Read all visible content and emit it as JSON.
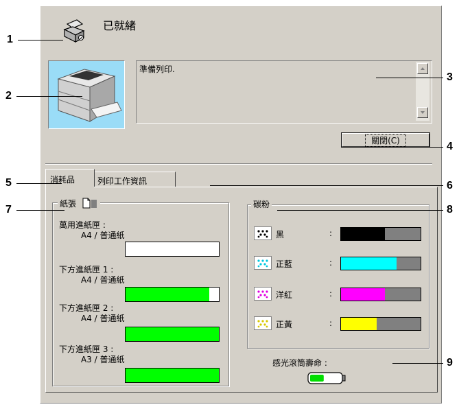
{
  "status": {
    "title": "已就緒",
    "message": "準備列印."
  },
  "buttons": {
    "close_label": "關閉(C)"
  },
  "tabs": [
    {
      "label": "消耗品"
    },
    {
      "label": "列印工作資訊"
    }
  ],
  "paper": {
    "group_label": "紙張",
    "trays": [
      {
        "name": "萬用進紙匣 :",
        "size": "A4 / 普通紙",
        "level": 0.0
      },
      {
        "name": "下方進紙匣 1 :",
        "size": "A4 / 普通紙",
        "level": 0.9
      },
      {
        "name": "下方進紙匣 2 :",
        "size": "A4 / 普通紙",
        "level": 1.0
      },
      {
        "name": "下方進紙匣 3 :",
        "size": "A3 / 普通紙",
        "level": 1.0
      }
    ]
  },
  "toner": {
    "group_label": "碳粉",
    "colon": ":",
    "items": [
      {
        "name": "黑",
        "color": "#000000",
        "level": 0.55
      },
      {
        "name": "正藍",
        "color": "#00ffff",
        "level": 0.7
      },
      {
        "name": "洋紅",
        "color": "#ff00ff",
        "level": 0.55
      },
      {
        "name": "正黃",
        "color": "#ffff00",
        "level": 0.45
      }
    ]
  },
  "photoconductor": {
    "label": "感光滾筒壽命 :",
    "level": 0.45
  },
  "callouts": [
    "1",
    "2",
    "3",
    "4",
    "5",
    "6",
    "7",
    "8",
    "9"
  ],
  "colors": {
    "panel": "#d4d0c8",
    "paper_fill": "#00ff00"
  }
}
